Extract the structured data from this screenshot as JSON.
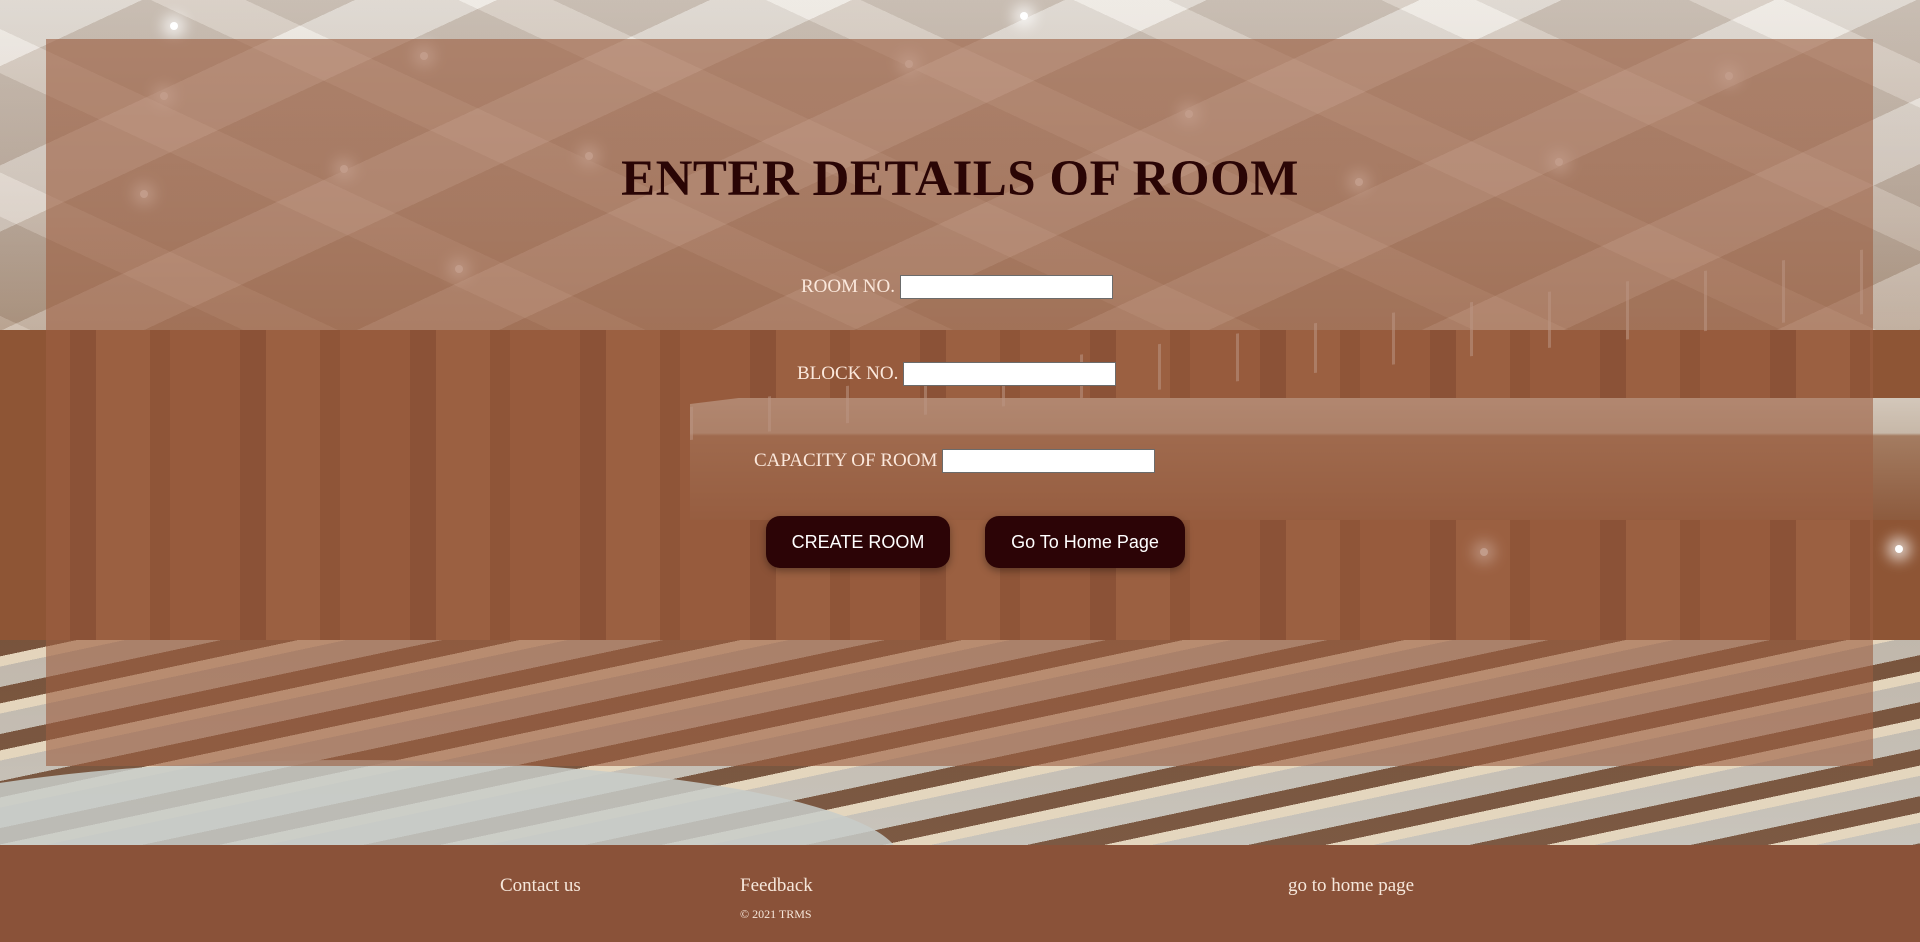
{
  "page": {
    "title": "ENTER DETAILS OF ROOM"
  },
  "form": {
    "room_no_label": "ROOM NO.",
    "room_no_value": "",
    "block_no_label": "BLOCK NO.",
    "block_no_value": "",
    "capacity_label": "CAPACITY OF ROOM",
    "capacity_value": ""
  },
  "buttons": {
    "create_room": "CREATE ROOM",
    "go_home": "Go To Home Page"
  },
  "footer": {
    "contact": "Contact us",
    "feedback": "Feedback",
    "copyright": "© 2021 TRMS",
    "home_link": "go to home page"
  },
  "colors": {
    "overlay": "#9c6042",
    "title": "#2a0505",
    "button_bg": "#2c0406",
    "footer_bg": "#8a5239",
    "label_text": "#fbe8dc"
  }
}
